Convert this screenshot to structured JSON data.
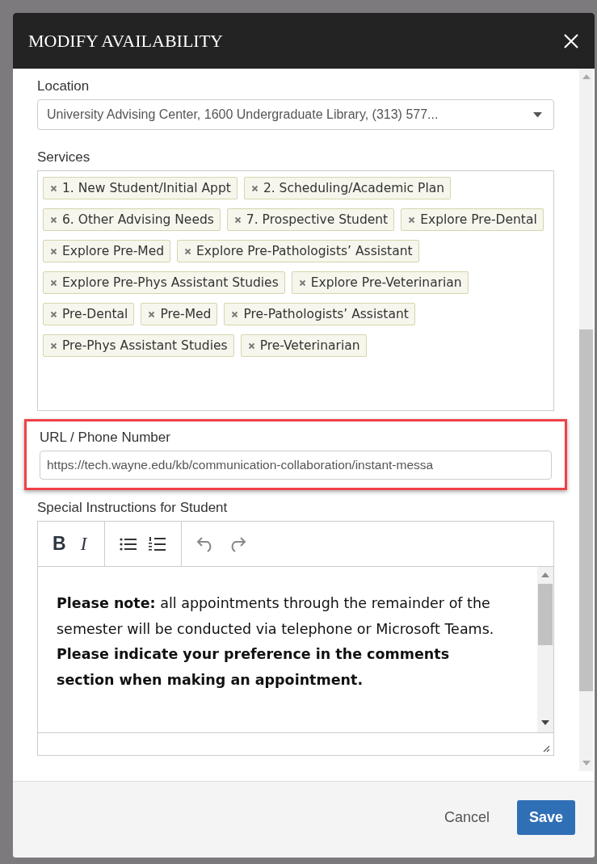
{
  "dialog": {
    "title": "MODIFY AVAILABILITY"
  },
  "location": {
    "label": "Location",
    "value": "University Advising Center, 1600 Undergraduate Library, (313) 577..."
  },
  "services": {
    "label": "Services",
    "tags": [
      {
        "label": "1. New Student/Initial Appt"
      },
      {
        "label": "2. Scheduling/Academic Plan"
      },
      {
        "label": "6. Other Advising Needs"
      },
      {
        "label": "7. Prospective Student"
      },
      {
        "label": "Explore Pre-Dental"
      },
      {
        "label": "Explore Pre-Med"
      },
      {
        "label": "Explore Pre-Pathologists’ Assistant"
      },
      {
        "label": "Explore Pre-Phys Assistant Studies"
      },
      {
        "label": "Explore Pre-Veterinarian"
      },
      {
        "label": "Pre-Dental"
      },
      {
        "label": "Pre-Med"
      },
      {
        "label": "Pre-Pathologists’ Assistant"
      },
      {
        "label": "Pre-Phys Assistant Studies"
      },
      {
        "label": "Pre-Veterinarian"
      }
    ]
  },
  "url": {
    "label": "URL / Phone Number",
    "value": "https://tech.wayne.edu/kb/communication-collaboration/instant-messa",
    "highlighted": true
  },
  "instructions": {
    "label": "Special Instructions for Student",
    "toolbar": [
      {
        "kind": "bold",
        "label": "B"
      },
      {
        "kind": "italic",
        "label": "I"
      },
      {
        "kind": "bullet-list"
      },
      {
        "kind": "numbered-list"
      },
      {
        "kind": "undo"
      },
      {
        "kind": "redo"
      }
    ],
    "text": "**Please note:** all appointments through the remainder of the semester will be conducted via telephone or Microsoft Teams.  **Please indicate your preference in the comments section when making an appointment.**"
  },
  "buttons": [
    {
      "label": "Cancel",
      "kind": "secondary"
    },
    {
      "label": "Save",
      "kind": "primary"
    }
  ]
}
